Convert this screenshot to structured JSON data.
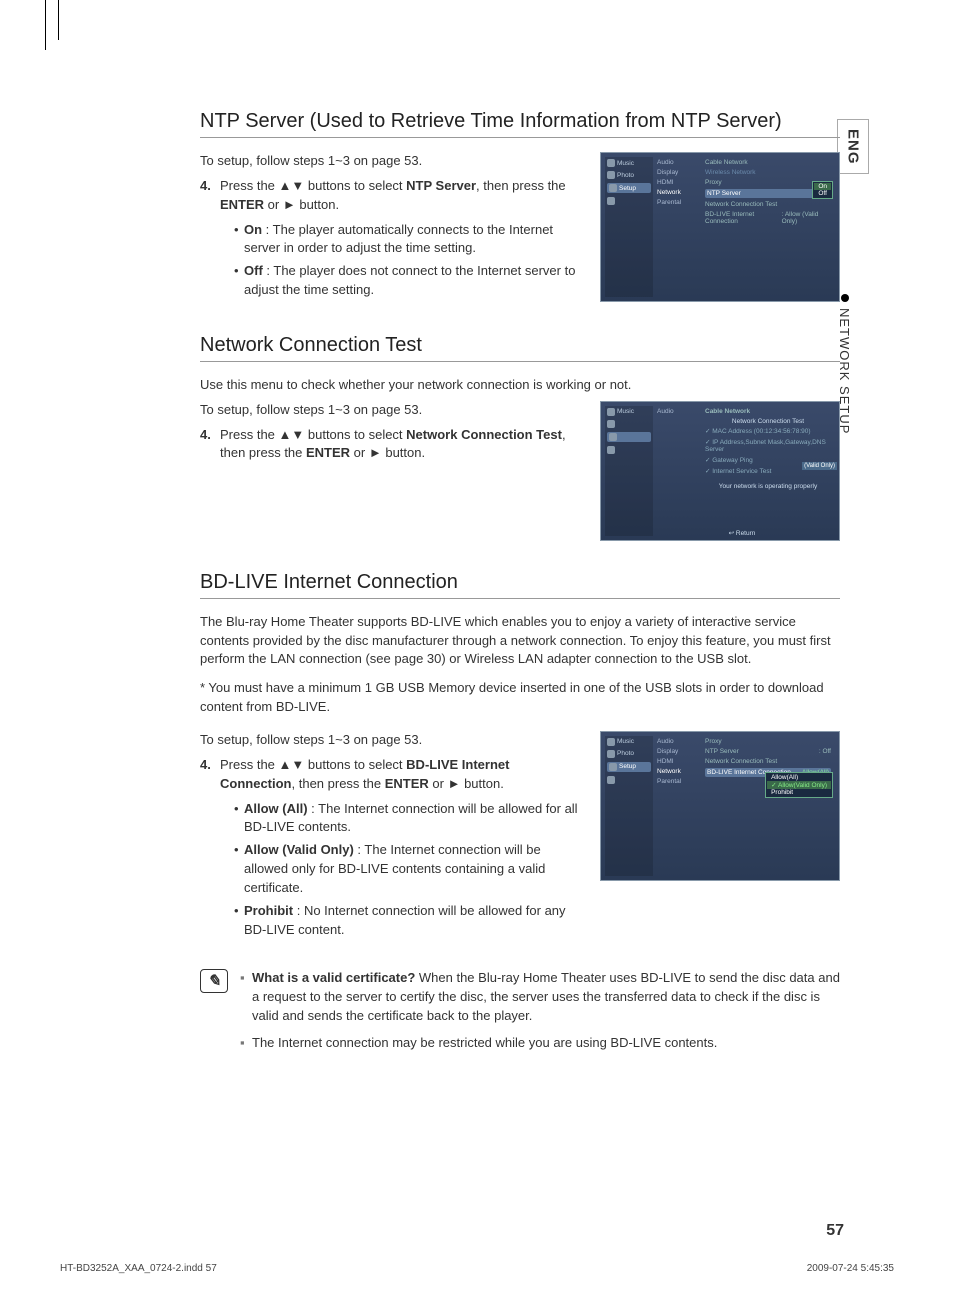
{
  "side": {
    "lang": "ENG",
    "section": "NETWORK SETUP"
  },
  "s1": {
    "title": "NTP Server (Used to Retrieve Time Information from NTP Server)",
    "intro": "To setup, follow steps 1~3 on page 53.",
    "step_num": "4.",
    "step_a": "Press the ",
    "step_b": " buttons to select ",
    "step_bold1": "NTP Server",
    "step_c": ", then press the ",
    "step_bold2": "ENTER",
    "step_d": " or ",
    "step_e": " button.",
    "on_label": "On",
    "on_text": " : The player automatically connects to the Internet server in order to adjust the time setting.",
    "off_label": "Off",
    "off_text": " : The player does not connect to the Internet server to adjust the time setting."
  },
  "s2": {
    "title": "Network Connection Test",
    "intro": "Use this menu to check whether your network connection is working or not.",
    "setup_line": "To setup, follow steps 1~3 on page 53.",
    "step_num": "4.",
    "step_a": "Press the ",
    "step_b": " buttons to select ",
    "step_bold1": "Network Connection Test",
    "step_c": ", then press the ",
    "step_bold2": "ENTER",
    "step_d": " or ",
    "step_e": " button."
  },
  "s3": {
    "title": "BD-LIVE Internet Connection",
    "p1": "The Blu-ray Home Theater supports BD-LIVE which enables you to enjoy a variety of interactive service contents provided by the disc manufacturer through a network connection. To enjoy this feature, you must first perform the LAN connection (see page 30) or Wireless LAN adapter connection to the USB slot.",
    "p2": "* You must have a minimum 1 GB USB Memory device inserted in one of the USB slots in order to download content from BD-LIVE.",
    "setup_line": "To setup, follow steps 1~3 on page 53.",
    "step_num": "4.",
    "step_a": "Press the ",
    "step_b": " buttons to select ",
    "step_bold1": "BD-LIVE Internet Connection",
    "step_c": ", then press the ",
    "step_bold2": "ENTER",
    "step_d": " or ",
    "step_e": " button.",
    "aa_label": "Allow (All)",
    "aa_text": " : The Internet connection will be allowed for all BD-LIVE contents.",
    "avo_label": "Allow (Valid Only)",
    "avo_text": " : The Internet connection will be allowed only for BD-LIVE contents containing a valid certificate.",
    "pr_label": "Prohibit",
    "pr_text": " : No Internet connection will be allowed for any BD-LIVE content."
  },
  "notes": {
    "n1a": "What is a valid certificate?",
    "n1b": " When the Blu-ray Home Theater uses BD-LIVE to send the disc data and a request to the server to certify the disc, the server uses the transferred data to check if the disc is valid and sends the certificate back to the player.",
    "n2": "The Internet connection may be restricted while you are using BD-LIVE contents."
  },
  "osd_common": {
    "left": {
      "music": "Music",
      "photo": "Photo",
      "setup": "Setup"
    },
    "mid": {
      "audio": "Audio",
      "display": "Display",
      "hdmi": "HDMI",
      "network": "Network",
      "parental": "Parental"
    }
  },
  "osd1": {
    "r0": "Cable Network",
    "r1": "Wireless Network",
    "r2": "Proxy",
    "r3": "NTP Server",
    "r3v": "On",
    "r4": "Network Connection Test",
    "r5": "BD-LIVE Internet Connection",
    "r5v": ": Allow (Valid Only)",
    "opt_on": "On",
    "opt_off": "Off"
  },
  "osd2": {
    "header": "Network Connection Test",
    "l1": "✓ MAC Address (00:12:34:56:78:90)",
    "l2": "✓ IP Address,Subnet Mask,Gateway,DNS Server",
    "l3": "✓ Gateway Ping",
    "l4": "✓ Internet Service Test",
    "msg": "Your network is operating properly",
    "ret": "Return",
    "badge": "(Valid Only)"
  },
  "osd3": {
    "r0": "Proxy",
    "r1": "NTP Server",
    "r1v": ": Off",
    "r2": "Network Connection Test",
    "r3": "BD-LIVE Internet Connection",
    "r3v": "Allow(All)",
    "opt1": "Allow(All)",
    "opt2": "Allow(Valid Only)",
    "opt3": "Prohibit"
  },
  "glyphs": {
    "ud": "▲▼",
    "r": "►"
  },
  "page_number": "57",
  "footer": {
    "left": "HT-BD3252A_XAA_0724-2.indd   57",
    "right": "2009-07-24   5:45:35"
  }
}
